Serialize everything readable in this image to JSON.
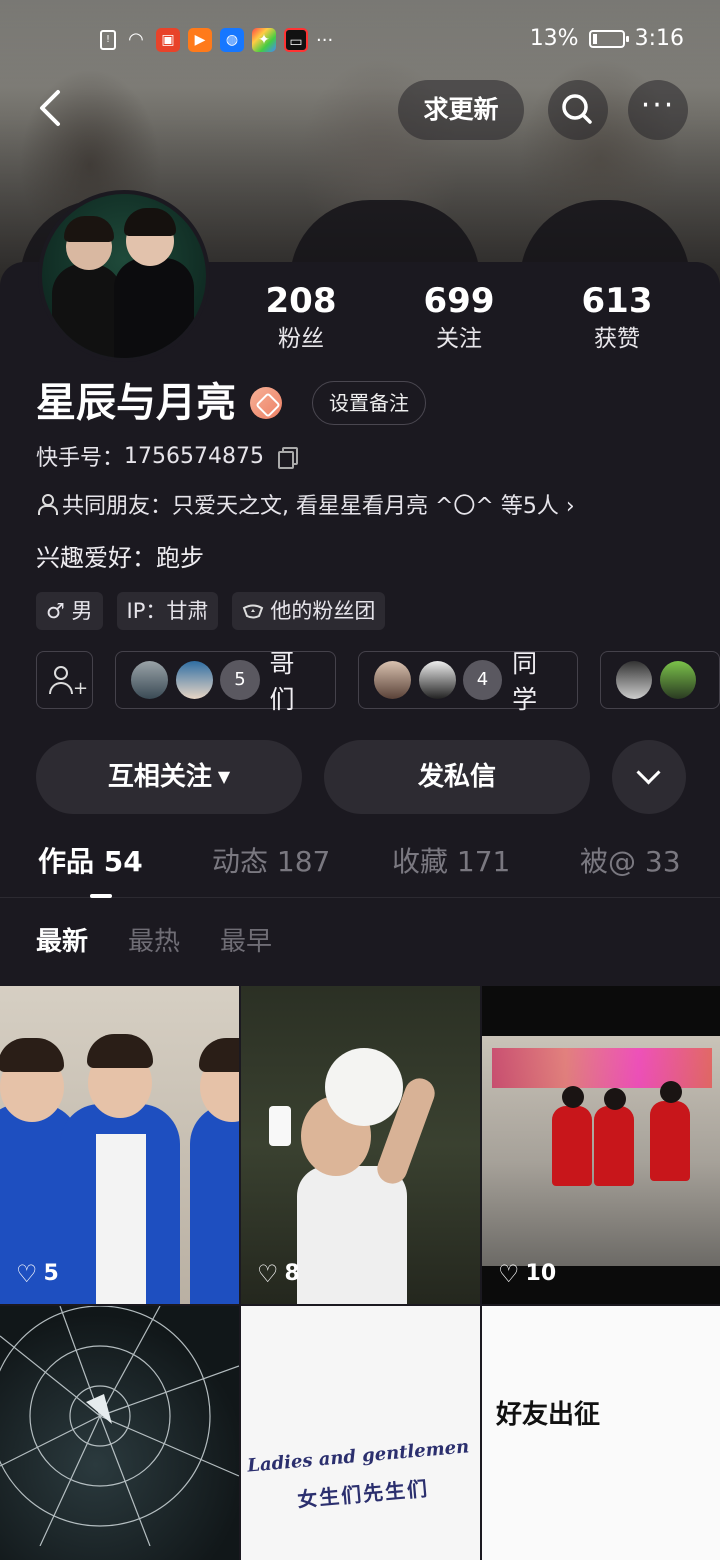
{
  "status_bar": {
    "battery": "13%",
    "time": "3:16",
    "app_icons": [
      "sim-icon",
      "wifi-icon",
      "app-icon-1",
      "app-icon-2",
      "app-icon-3",
      "app-icon-4",
      "app-icon-5"
    ],
    "more": "···"
  },
  "nav": {
    "back": "‹",
    "request_update": "求更新",
    "more": "···"
  },
  "profile": {
    "name": "星辰与月亮",
    "set_remark": "设置备注",
    "kuaishou_id_label": "快手号：",
    "kuaishou_id": "1756574875",
    "mutual_friends": "共同朋友：只爱天之文, 看星星看月亮 ^〇^ 等5人 ›",
    "hobby": "兴趣爱好：跑步",
    "stats": [
      {
        "num": "208",
        "label": "粉丝"
      },
      {
        "num": "699",
        "label": "关注"
      },
      {
        "num": "613",
        "label": "获赞"
      }
    ],
    "tags": [
      "♂ 男",
      "IP：甘肃",
      "他的粉丝团"
    ]
  },
  "groups": [
    {
      "count": "5",
      "label": "哥们"
    },
    {
      "count": "4",
      "label": "同学"
    }
  ],
  "actions": {
    "follow": "互相关注",
    "message": "发私信"
  },
  "tabs": [
    {
      "label": "作品 54"
    },
    {
      "label": "动态 187"
    },
    {
      "label": "收藏 171"
    },
    {
      "label": "被@ 33"
    }
  ],
  "subtabs": [
    "最新",
    "最热",
    "最早"
  ],
  "grid": [
    {
      "likes": "5"
    },
    {
      "likes": "8"
    },
    {
      "likes": "10"
    },
    {
      "caption": "",
      "likes": ""
    },
    {
      "caption1": "Ladies and gentlemen",
      "caption2": "女生们先生们"
    },
    {
      "caption": "好友出征"
    }
  ],
  "colors": {
    "panel": "#1b1920",
    "button": "#2d2b32",
    "verify_badge": "#ec7f64"
  }
}
